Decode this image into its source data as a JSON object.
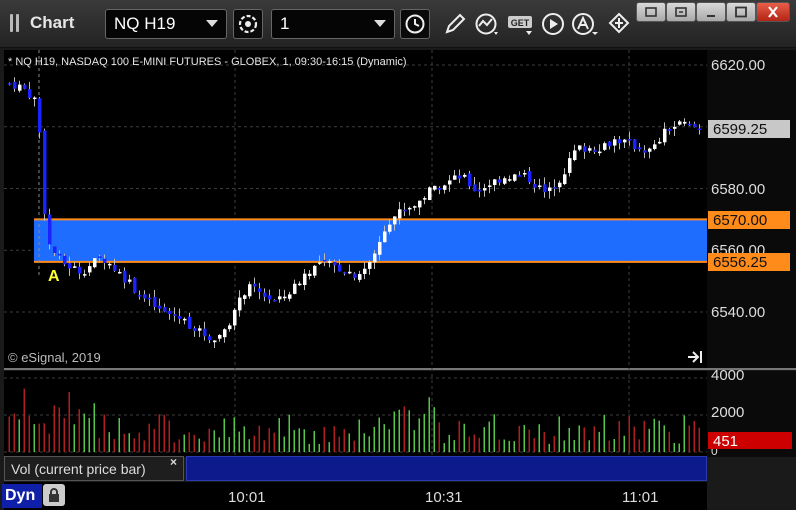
{
  "window": {
    "title": "Chart"
  },
  "toolbar": {
    "symbol": "NQ H19",
    "interval": "1",
    "icons": [
      "refresh-icon",
      "clock-icon",
      "pencil-icon",
      "study-icon",
      "get-icon",
      "play-icon",
      "alert-icon",
      "diamond-arrows-icon"
    ]
  },
  "chart": {
    "header": "* NQ H19, NASDAQ 100 E-MINI FUTURES - GLOBEX, 1, 09:30-16:15 (Dynamic)",
    "copyright": "© eSignal, 2019",
    "marker_label": "A",
    "price_axis": [
      "6620.00",
      "6600.00",
      "6580.00",
      "6560.00",
      "6540.00"
    ],
    "last_price": "6599.25",
    "zone_top": "6570.00",
    "zone_bottom": "6556.25",
    "volume_axis": [
      "4000",
      "2000",
      "0"
    ],
    "last_volume": "451",
    "time_axis": [
      "10:01",
      "10:31",
      "11:01"
    ],
    "colors": {
      "up": "#ffffff",
      "down": "#1a22ff",
      "zone": "#1f6dff",
      "zone_border": "#ff8c1a",
      "vol_up": "#55c84a",
      "vol_down": "#b01e1e",
      "last_price_bg": "#c8c8c8",
      "volume_badge": "#cc0000"
    }
  },
  "volume_panel": {
    "label": "Vol (current price bar)",
    "close_glyph": "×"
  },
  "footer": {
    "label": "Dyn"
  }
}
